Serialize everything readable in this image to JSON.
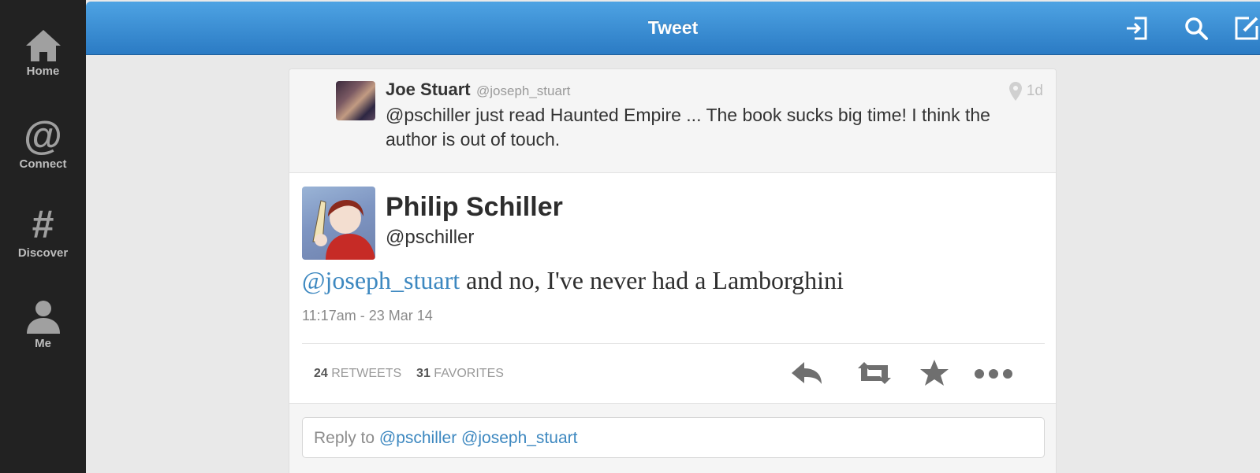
{
  "sidebar": {
    "items": [
      {
        "label": "Home",
        "icon": "home-icon"
      },
      {
        "label": "Connect",
        "icon": "at-icon",
        "glyph": "@"
      },
      {
        "label": "Discover",
        "icon": "hash-icon",
        "glyph": "#"
      },
      {
        "label": "Me",
        "icon": "person-icon"
      }
    ]
  },
  "header": {
    "title": "Tweet",
    "icons": [
      "sign-out-icon",
      "search-icon",
      "compose-icon"
    ]
  },
  "parent_tweet": {
    "name": "Joe Stuart",
    "handle": "@joseph_stuart",
    "time": "1d",
    "text": "@pschiller just read Haunted Empire ... The book sucks big time! I think the author is out of touch."
  },
  "tweet": {
    "name": "Philip Schiller",
    "handle": "@pschiller",
    "mention": "@joseph_stuart",
    "text": " and no, I've never had a Lamborghini",
    "timestamp": "11:17am - 23 Mar 14",
    "retweets_count": "24",
    "retweets_label": "RETWEETS",
    "favorites_count": "31",
    "favorites_label": "FAVORITES"
  },
  "reply": {
    "prefix": "Reply to ",
    "mentions": "@pschiller @joseph_stuart"
  },
  "colors": {
    "header_top": "#4ea3e3",
    "header_bottom": "#2b7bc4",
    "sidebar": "#222222",
    "mention": "#3d88c0"
  }
}
